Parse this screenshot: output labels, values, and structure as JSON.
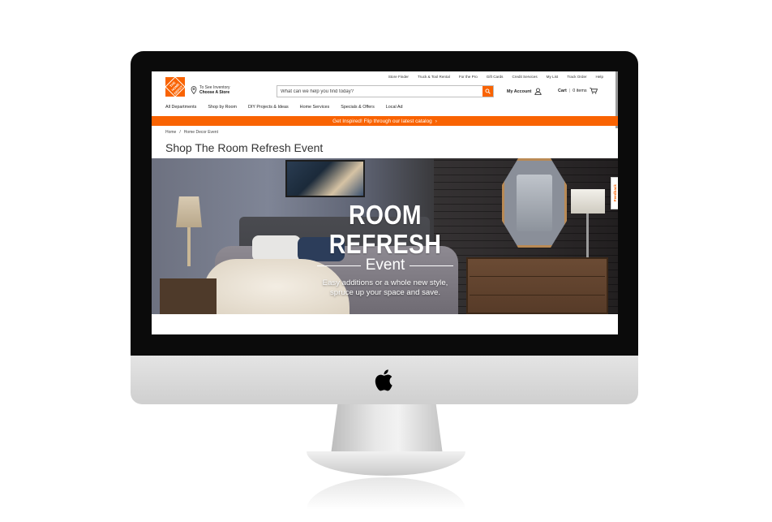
{
  "utility_nav": [
    "Store Finder",
    "Truck & Tool Rental",
    "For the Pro",
    "Gift Cards",
    "Credit Services",
    "My List",
    "Track Order",
    "Help"
  ],
  "header": {
    "logo_text": "THE HOME DEPOT",
    "store_line1": "To See Inventory",
    "store_line2": "Choose A Store",
    "search_placeholder": "What can we help you find today?",
    "account_label": "My Account",
    "cart_label": "Cart",
    "cart_count": "0 items"
  },
  "main_nav": [
    "All Departments",
    "Shop by Room",
    "DIY Projects & Ideas",
    "Home Services",
    "Specials & Offers",
    "Local Ad"
  ],
  "promo": {
    "text": "Get Inspired! Flip through our latest catalog",
    "chevron": "›"
  },
  "breadcrumb": {
    "home": "Home",
    "separator": "/",
    "current": "Home Decor Event"
  },
  "page_title": "Shop The Room Refresh Event",
  "hero": {
    "title": "ROOM REFRESH",
    "subtitle": "Event",
    "desc_line1": "Easy additions or a whole new style,",
    "desc_line2": "spruce up your space and save."
  },
  "feedback_label": "Feedback",
  "colors": {
    "brand_orange": "#f96302",
    "text_dark": "#333333"
  },
  "icons": {
    "store": "pin-icon",
    "search": "search-icon",
    "account": "user-icon",
    "cart": "cart-icon",
    "apple": "apple-logo-icon"
  }
}
